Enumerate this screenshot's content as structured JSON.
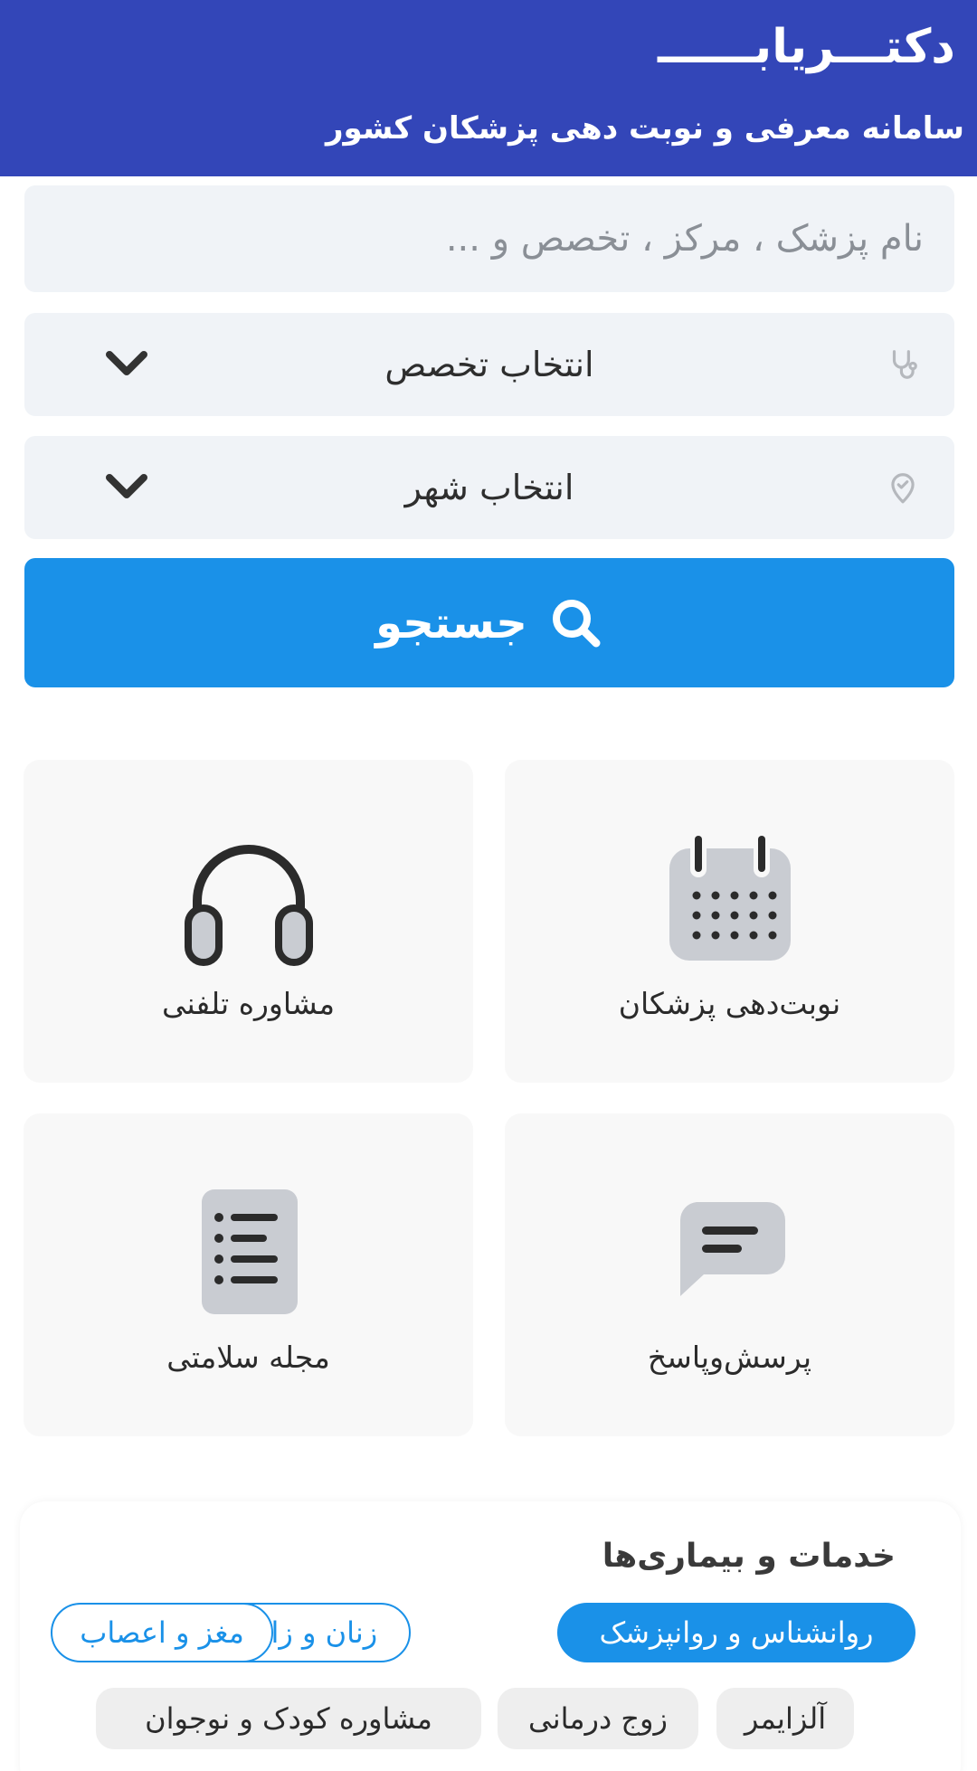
{
  "header": {
    "brand": "دکتـــریابــــــ",
    "tagline": "سامانه معرفی و نوبت دهی پزشکان کشور"
  },
  "search": {
    "placeholder": "نام پزشک ، مرکز ، تخصص و ...",
    "specialty_select": "انتخاب تخصص",
    "city_select": "انتخاب شهر",
    "button_label": "جستجو"
  },
  "cards": {
    "appointments": "نوبت‌دهی پزشکان",
    "phone": "مشاوره تلفنی",
    "qa": "پرسش‌وپاسخ",
    "magazine": "مجله سلامتی"
  },
  "services": {
    "title": "خدمات و بیماری‌ها",
    "chips": [
      "روانشناس و روانپزشک",
      "زنان و زایمان",
      "مغز و اعصاب",
      "آلزایمر",
      "زوج درمانی",
      "مشاوره کودک و نوجوان"
    ]
  },
  "colors": {
    "header": "#3346b8",
    "accent": "#1a91e8",
    "field_bg": "#f0f3f7",
    "card_bg": "#f8f8f8"
  },
  "icons": {
    "specialty": "stethoscope-icon",
    "city": "location-pin-icon",
    "dropdown": "chevron-down-icon",
    "search": "search-icon",
    "appointments": "calendar-icon",
    "phone": "headphones-icon",
    "qa": "chat-bubble-icon",
    "magazine": "document-list-icon"
  }
}
